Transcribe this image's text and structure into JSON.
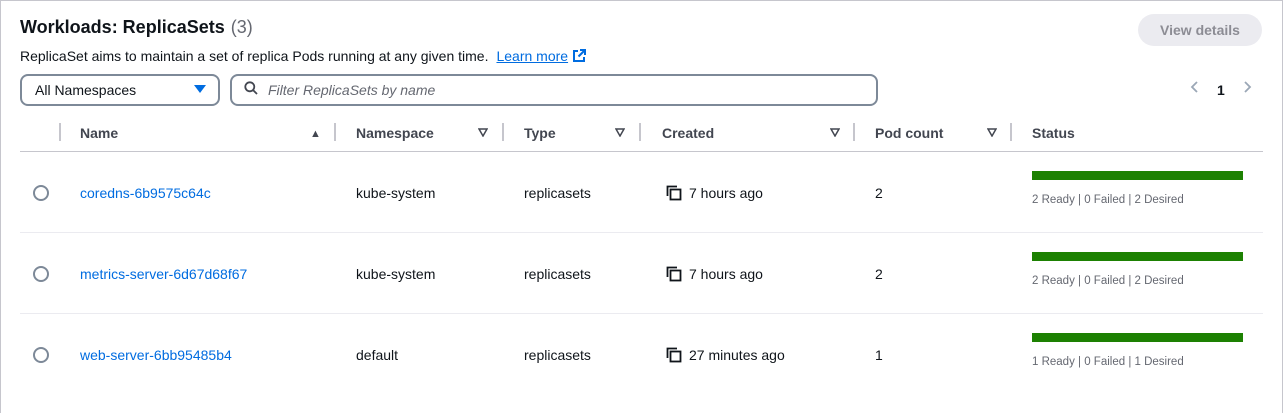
{
  "header": {
    "title": "Workloads: ReplicaSets",
    "count": "(3)",
    "description": "ReplicaSet aims to maintain a set of replica Pods running at any given time.",
    "learn_more": "Learn more",
    "view_details": "View details"
  },
  "filters": {
    "namespace": "All Namespaces",
    "search_placeholder": "Filter ReplicaSets by name"
  },
  "pagination": {
    "current_page": "1",
    "prev": "‹",
    "next": "›"
  },
  "columns": {
    "name": "Name",
    "namespace": "Namespace",
    "type": "Type",
    "created": "Created",
    "pod_count": "Pod count",
    "status": "Status"
  },
  "rows": [
    {
      "name": "coredns-6b9575c64c",
      "namespace": "kube-system",
      "type": "replicasets",
      "created": "7 hours ago",
      "pod_count": "2",
      "ready_fraction": 1.0,
      "status": "2 Ready | 0 Failed | 2 Desired"
    },
    {
      "name": "metrics-server-6d67d68f67",
      "namespace": "kube-system",
      "type": "replicasets",
      "created": "7 hours ago",
      "pod_count": "2",
      "ready_fraction": 1.0,
      "status": "2 Ready | 0 Failed | 2 Desired"
    },
    {
      "name": "web-server-6bb95485b4",
      "namespace": "default",
      "type": "replicasets",
      "created": "27 minutes ago",
      "pod_count": "1",
      "ready_fraction": 1.0,
      "status": "1 Ready | 0 Failed | 1 Desired"
    }
  ],
  "colors": {
    "link": "#006ce0",
    "status_ready": "#1d8102"
  },
  "icons": {
    "external_link": "external-link-icon",
    "search": "search-icon",
    "copy": "copy-icon",
    "sort_ascending": "sort-ascending-icon",
    "sort_descending": "sort-descending-icon"
  }
}
